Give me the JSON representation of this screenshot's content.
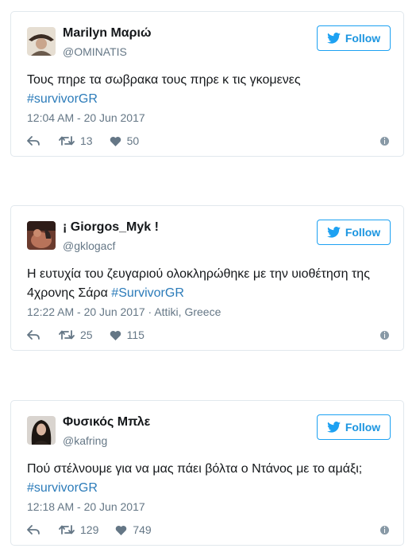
{
  "tweets": [
    {
      "name": "Marilyn Μαριώ",
      "handle": "@OMINATIS",
      "follow_label": "Follow",
      "text": "Τους πηρε τα σωβρακα τους πηρε κ τις γκομενες",
      "hashtag": "#survivorGR",
      "time": "12:04 AM - 20 Jun 2017",
      "retweets": "13",
      "likes": "50"
    },
    {
      "name": "¡ Giorgos_Myk !",
      "handle": "@gklogacf",
      "follow_label": "Follow",
      "text": "Η ευτυχία του ζευγαριού ολοκληρώθηκε με την υιοθέτηση της 4χρονης Σάρα",
      "hashtag": "#SurvivorGR",
      "time": "12:22 AM - 20 Jun 2017 · Attiki, Greece",
      "retweets": "25",
      "likes": "115"
    },
    {
      "name": "Φυσικός Μπλε",
      "handle": "@kafring",
      "follow_label": "Follow",
      "text": "Πού στέλνουμε για να μας πάει βόλτα ο Ντάνος με το αμάξι;",
      "hashtag": "#survivorGR",
      "time": "12:18 AM - 20 Jun 2017",
      "retweets": "129",
      "likes": "749"
    }
  ],
  "colors": {
    "accent": "#1da1f2",
    "hashtag": "#2b7bb9",
    "muted": "#657786",
    "border": "#e1e8ed"
  },
  "icons": [
    "avatar-image",
    "twitter-bird-icon",
    "reply-icon",
    "retweet-icon",
    "heart-icon",
    "info-icon"
  ]
}
